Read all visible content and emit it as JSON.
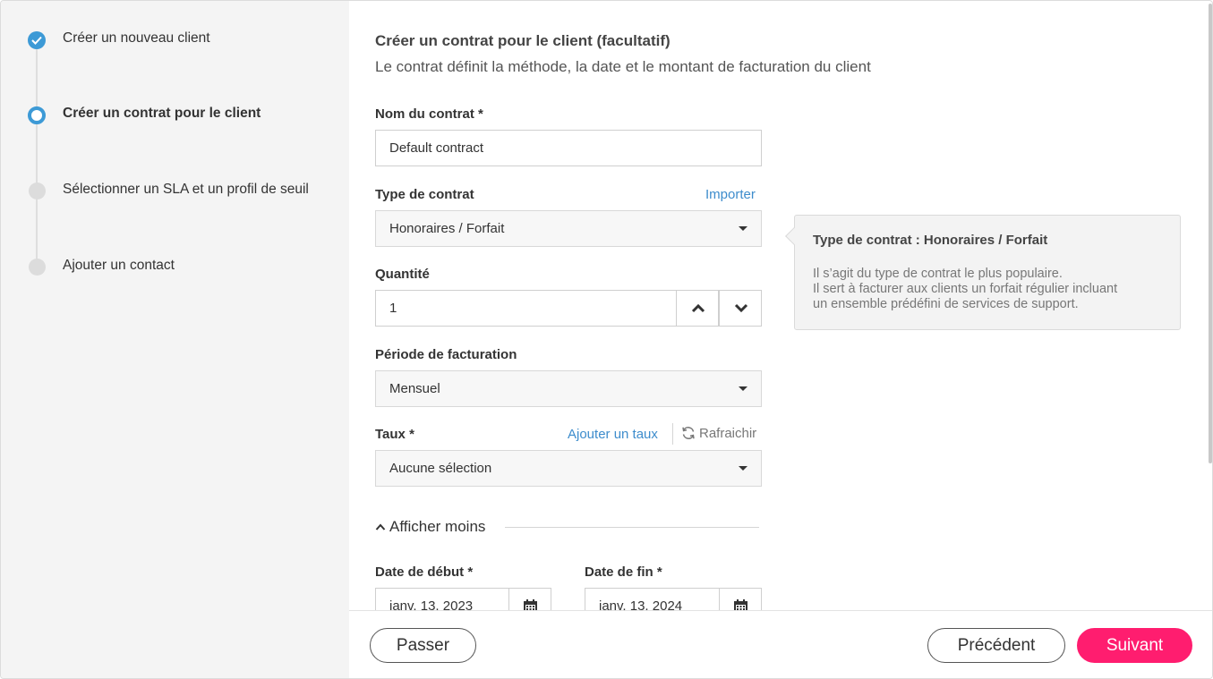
{
  "steps": [
    {
      "label": "Créer un nouveau client",
      "state": "done"
    },
    {
      "label": "Créer un contrat pour le client",
      "state": "current"
    },
    {
      "label": "Sélectionner un SLA et un profil de seuil",
      "state": "todo"
    },
    {
      "label": "Ajouter un contact",
      "state": "todo"
    }
  ],
  "header": {
    "title": "Créer un contrat pour le client (facultatif)",
    "subtitle": "Le contrat définit la méthode, la date et le montant de facturation du client"
  },
  "form": {
    "contract_name": {
      "label": "Nom du contrat *",
      "value": "Default contract"
    },
    "contract_type": {
      "label": "Type de contrat",
      "import_link": "Importer",
      "value": "Honoraires / Forfait"
    },
    "quantity": {
      "label": "Quantité",
      "value": "1"
    },
    "billing_period": {
      "label": "Période de facturation",
      "value": "Mensuel"
    },
    "rate": {
      "label": "Taux *",
      "add_link": "Ajouter un taux",
      "refresh": "Rafraichir",
      "value": "Aucune sélection"
    },
    "toggle_label": "Afficher moins",
    "start_date": {
      "label": "Date de début *",
      "value": "janv. 13, 2023"
    },
    "end_date": {
      "label": "Date de fin *",
      "value": "janv. 13, 2024"
    }
  },
  "tooltip": {
    "title": "Type de contrat : Honoraires / Forfait",
    "lines": [
      "Il s’agit du type de contrat le plus populaire.",
      "Il sert à facturer aux clients un forfait régulier incluant",
      "un ensemble prédéfini de services de support."
    ]
  },
  "footer": {
    "skip": "Passer",
    "previous": "Précédent",
    "next": "Suivant"
  },
  "colors": {
    "accent": "#3d9ad6",
    "primary_button": "#ff1d6f",
    "link": "#3d8ccc"
  }
}
